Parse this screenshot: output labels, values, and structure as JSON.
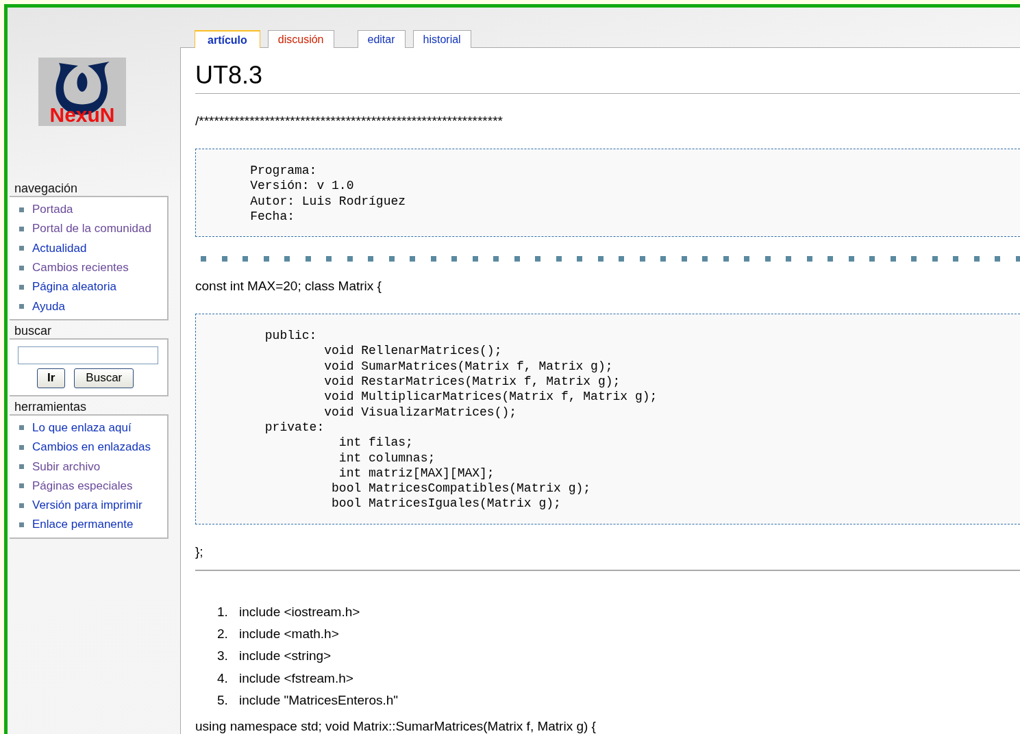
{
  "logo": {
    "text": "NexuN"
  },
  "tabs": [
    {
      "label": "artículo",
      "selected": true,
      "exists": true
    },
    {
      "label": "discusión",
      "selected": false,
      "exists": false
    },
    {
      "label": "editar",
      "selected": false,
      "exists": true
    },
    {
      "label": "historial",
      "selected": false,
      "exists": true
    }
  ],
  "sidebar": {
    "navigation": {
      "title": "navegación",
      "items": [
        {
          "label": "Portada",
          "visited": true
        },
        {
          "label": "Portal de la comunidad",
          "visited": true
        },
        {
          "label": "Actualidad",
          "visited": false
        },
        {
          "label": "Cambios recientes",
          "visited": true
        },
        {
          "label": "Página aleatoria",
          "visited": false
        },
        {
          "label": "Ayuda",
          "visited": false
        }
      ]
    },
    "search": {
      "title": "buscar",
      "buttons": [
        "Ir",
        "Buscar"
      ]
    },
    "tools": {
      "title": "herramientas",
      "items": [
        {
          "label": "Lo que enlaza aquí",
          "visited": false
        },
        {
          "label": "Cambios en enlazadas",
          "visited": false
        },
        {
          "label": "Subir archivo",
          "visited": true
        },
        {
          "label": "Páginas especiales",
          "visited": true
        },
        {
          "label": "Versión para imprimir",
          "visited": false
        },
        {
          "label": "Enlace permanente",
          "visited": false
        }
      ]
    }
  },
  "article": {
    "title": "UT8.3",
    "blocks": [
      {
        "kind": "text",
        "text": "/************************************************************"
      },
      {
        "kind": "code",
        "lines": [
          "    Programa:",
          "    Versión: v 1.0",
          "    Autor: Luis Rodríguez",
          "    Fecha:"
        ]
      },
      {
        "kind": "dots"
      },
      {
        "kind": "text",
        "text": "const int MAX=20; class Matrix {"
      },
      {
        "kind": "code",
        "lines": [
          "      public:",
          "              void RellenarMatrices();",
          "              void SumarMatrices(Matrix f, Matrix g);",
          "              void RestarMatrices(Matrix f, Matrix g);",
          "              void MultiplicarMatrices(Matrix f, Matrix g);",
          "              void VisualizarMatrices();",
          "      private:",
          "                int filas;",
          "                int columnas;",
          "                int matriz[MAX][MAX];",
          "               bool MatricesCompatibles(Matrix g);",
          "               bool MatricesIguales(Matrix g);"
        ]
      },
      {
        "kind": "text",
        "text": "};"
      },
      {
        "kind": "rule"
      },
      {
        "kind": "list",
        "items": [
          {
            "number": "1.",
            "text": "include <iostream.h>"
          },
          {
            "number": "2.",
            "text": "include <math.h>"
          },
          {
            "number": "3.",
            "text": "include <string>"
          },
          {
            "number": "4.",
            "text": "include <fstream.h>"
          },
          {
            "number": "5.",
            "text": "include \"MatricesEnteros.h\""
          }
        ]
      },
      {
        "kind": "text",
        "text": "using namespace std; void Matrix::SumarMatrices(Matrix f, Matrix g) {"
      }
    ]
  }
}
